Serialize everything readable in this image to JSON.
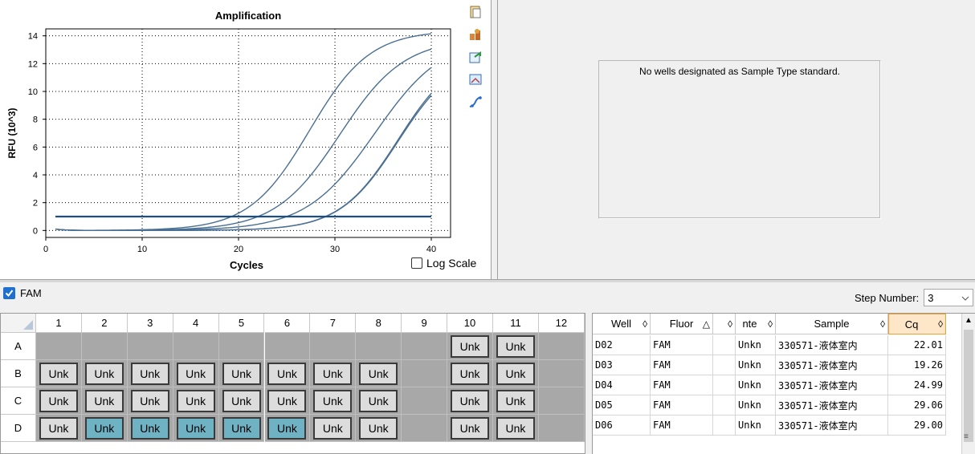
{
  "chart": {
    "title": "Amplification",
    "xlabel": "Cycles",
    "ylabel": "RFU (10^3)",
    "log_scale_label": "Log Scale"
  },
  "chart_data": {
    "type": "line",
    "title": "Amplification",
    "xlabel": "Cycles",
    "ylabel": "RFU (10^3)",
    "xlim": [
      0,
      42
    ],
    "ylim": [
      -0.5,
      14.5
    ],
    "xticks": [
      0,
      10,
      20,
      30,
      40
    ],
    "yticks": [
      0,
      2,
      4,
      6,
      8,
      10,
      12,
      14
    ],
    "grid": true,
    "threshold": 1.0,
    "curve_color": "#4a6f94",
    "threshold_color": "#1c4f80",
    "series": [
      {
        "cq": 19.26,
        "plateau": 14.4,
        "slope": 0.32,
        "x": [
          1,
          5,
          10,
          15,
          18,
          19.26,
          20,
          22,
          24,
          26,
          28,
          30,
          32,
          34,
          36,
          38,
          40
        ],
        "values": [
          0.1,
          0.05,
          0.0,
          0.0,
          0.5,
          1.0,
          1.5,
          3.8,
          6.9,
          9.0,
          10.6,
          11.5,
          12.2,
          12.7,
          13.1,
          13.5,
          13.8
        ]
      },
      {
        "cq": 22.01,
        "plateau": 13.8,
        "slope": 0.3,
        "x": [
          1,
          5,
          10,
          15,
          20,
          22.01,
          24,
          26,
          28,
          30,
          32,
          34,
          36,
          38,
          40
        ],
        "values": [
          0.1,
          0.05,
          0.0,
          0.0,
          0.4,
          1.0,
          3.2,
          6.3,
          8.8,
          10.2,
          11.2,
          11.9,
          12.4,
          12.8,
          13.1
        ]
      },
      {
        "cq": 24.99,
        "plateau": 14.0,
        "slope": 0.28,
        "x": [
          1,
          5,
          10,
          15,
          20,
          23,
          24.99,
          26,
          28,
          30,
          32,
          34,
          36,
          38,
          40
        ],
        "values": [
          0.1,
          0.05,
          0.0,
          0.0,
          0.1,
          0.5,
          1.0,
          2.0,
          5.2,
          8.0,
          9.8,
          11.0,
          11.9,
          12.5,
          13.0
        ]
      },
      {
        "cq": 29.06,
        "plateau": 12.8,
        "slope": 0.33,
        "x": [
          1,
          5,
          10,
          15,
          20,
          25,
          28,
          29.06,
          30,
          32,
          34,
          36,
          38,
          40
        ],
        "values": [
          0.1,
          0.05,
          0.0,
          0.0,
          0.0,
          0.2,
          0.7,
          1.0,
          1.5,
          3.9,
          6.6,
          8.6,
          10.0,
          11.0
        ]
      },
      {
        "cq": 29.0,
        "plateau": 13.0,
        "slope": 0.33,
        "x": [
          1,
          5,
          10,
          15,
          20,
          25,
          28,
          29.0,
          30,
          32,
          34,
          36,
          38,
          40
        ],
        "values": [
          0.1,
          0.05,
          0.0,
          0.0,
          0.0,
          0.2,
          0.7,
          1.0,
          1.6,
          4.2,
          7.0,
          9.0,
          10.4,
          11.4
        ]
      }
    ]
  },
  "toolbar": {
    "icons": [
      "copy-icon",
      "export-icon",
      "refresh-icon",
      "image-icon",
      "curve-icon"
    ]
  },
  "standard_panel": {
    "message": "No wells designated as Sample Type standard."
  },
  "filter": {
    "fluor_label": "FAM",
    "step_label": "Step Number:",
    "step_value": "3"
  },
  "plate": {
    "columns": [
      "1",
      "2",
      "3",
      "4",
      "5",
      "6",
      "7",
      "8",
      "9",
      "10",
      "11",
      "12"
    ],
    "rows": [
      {
        "label": "A",
        "wells": [
          "",
          "",
          "",
          "",
          "",
          "",
          "",
          "",
          "",
          "Unk",
          "Unk",
          ""
        ]
      },
      {
        "label": "B",
        "wells": [
          "Unk",
          "Unk",
          "Unk",
          "Unk",
          "Unk",
          "Unk",
          "Unk",
          "Unk",
          "",
          "Unk",
          "Unk",
          ""
        ]
      },
      {
        "label": "C",
        "wells": [
          "Unk",
          "Unk",
          "Unk",
          "Unk",
          "Unk",
          "Unk",
          "Unk",
          "Unk",
          "",
          "Unk",
          "Unk",
          ""
        ]
      },
      {
        "label": "D",
        "wells": [
          "Unk",
          "Unk",
          "Unk",
          "Unk",
          "Unk",
          "Unk",
          "Unk",
          "Unk",
          "",
          "Unk",
          "Unk",
          ""
        ],
        "selected": [
          1,
          2,
          3,
          4,
          5
        ]
      }
    ]
  },
  "results": {
    "headers": {
      "well": "Well",
      "fluor": "Fluor",
      "target": "",
      "content": "nte",
      "sample": "Sample",
      "cq": "Cq"
    },
    "rows": [
      {
        "well": "D02",
        "fluor": "FAM",
        "target": "",
        "content": "Unkn",
        "sample": "330571-液体室内",
        "cq": "22.01"
      },
      {
        "well": "D03",
        "fluor": "FAM",
        "target": "",
        "content": "Unkn",
        "sample": "330571-液体室内",
        "cq": "19.26"
      },
      {
        "well": "D04",
        "fluor": "FAM",
        "target": "",
        "content": "Unkn",
        "sample": "330571-液体室内",
        "cq": "24.99"
      },
      {
        "well": "D05",
        "fluor": "FAM",
        "target": "",
        "content": "Unkn",
        "sample": "330571-液体室内",
        "cq": "29.06"
      },
      {
        "well": "D06",
        "fluor": "FAM",
        "target": "",
        "content": "Unkn",
        "sample": "330571-液体室内",
        "cq": "29.00"
      }
    ]
  }
}
